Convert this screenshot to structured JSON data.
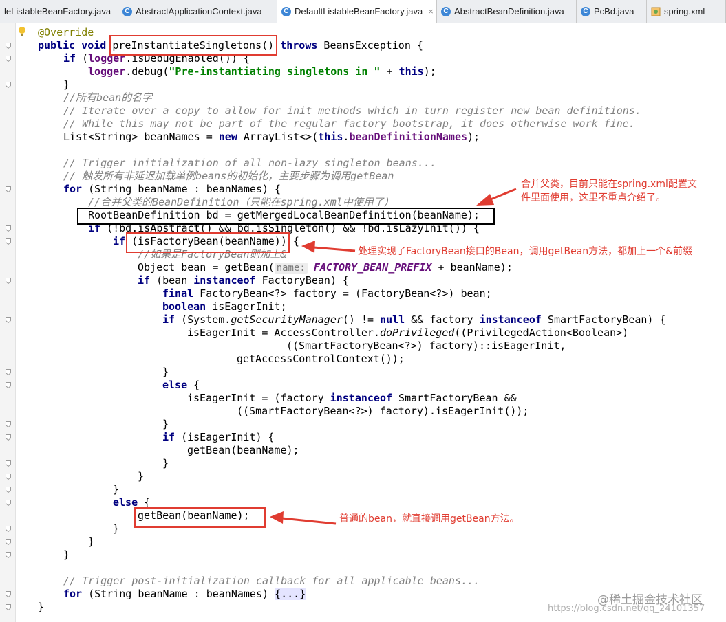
{
  "tabs": [
    {
      "label": "leListableBeanFactory.java",
      "icon": "none",
      "active": false
    },
    {
      "label": "AbstractApplicationContext.java",
      "icon": "class-icon",
      "active": false
    },
    {
      "label": "DefaultListableBeanFactory.java",
      "icon": "class-icon",
      "active": true
    },
    {
      "label": "AbstractBeanDefinition.java",
      "icon": "class-icon",
      "active": false
    },
    {
      "label": "PcBd.java",
      "icon": "class-icon",
      "active": false
    },
    {
      "label": "spring.xml",
      "icon": "xml-icon",
      "active": false
    }
  ],
  "tab_close": "×",
  "colors": {
    "keyword": "#000080",
    "comment": "#808080",
    "annotation": "#808000",
    "string": "#008000",
    "field": "#660e7a",
    "annotation_red": "#e03c31"
  },
  "code": {
    "annotation": "@Override",
    "l1_kw": "public void ",
    "l1_method": "preInstantiateSingletons()",
    "l1_throws": " throws",
    "l1_rest": " BeansException {",
    "l2_kw": "if",
    "l2_a": " (",
    "l2_logger": "logger",
    "l2_b": ".isDebugEnabled()) {",
    "l3_logger": "logger",
    "l3_a": ".debug(",
    "l3_str": "\"Pre-instantiating singletons in \"",
    "l3_b": " + ",
    "l3_this": "this",
    "l3_c": ");",
    "l4": "}",
    "c1": "//所有bean的名字",
    "c2": "// Iterate over a copy to allow for init methods which in turn register new bean definitions.",
    "c3": "// While this may not be part of the regular factory bootstrap, it does otherwise work fine.",
    "l8_a": "List<String> beanNames = ",
    "l8_new": "new",
    "l8_b": " ArrayList<>(",
    "l8_this": "this",
    "l8_c": ".",
    "l8_field": "beanDefinitionNames",
    "l8_d": ");",
    "c4": "// Trigger initialization of all non-lazy singleton beans...",
    "c5": "// 触发所有非延迟加载单例beans的初始化，主要步骤为调用getBean",
    "l12_for": "for",
    "l12_a": " (String beanName : beanNames) {",
    "c6": "//合并父类的BeanDefinition（只能在spring.xml中使用了）",
    "l14": "RootBeanDefinition bd = getMergedLocalBeanDefinition(beanName);",
    "l15_if": "if",
    "l15_a": " (!bd.isAbstract() && bd.isSingleton() && !bd.isLazyInit()) {",
    "l16_if": "if",
    "l16_a": " (isFactoryBean(beanName)) {",
    "c7": "//如果是FactoryBean则加上&",
    "l18_a": "Object bean = getBean(",
    "l18_hint": "name:",
    "l18_const": " FACTORY_BEAN_PREFIX",
    "l18_b": " + beanName);",
    "l19_if": "if",
    "l19_a": " (bean ",
    "l19_inst": "instanceof",
    "l19_b": " FactoryBean) {",
    "l20_final": "final",
    "l20_a": " FactoryBean<?> factory = (FactoryBean<?>) bean;",
    "l21_bool": "boolean",
    "l21_a": " isEagerInit;",
    "l22_if": "if",
    "l22_a": " (System.",
    "l22_it": "getSecurityManager",
    "l22_b": "() != ",
    "l22_null": "null",
    "l22_c": " && factory ",
    "l22_inst": "instanceof",
    "l22_d": " SmartFactoryBean) {",
    "l23_a": "isEagerInit = AccessController.",
    "l23_it": "doPrivileged",
    "l23_b": "((PrivilegedAction<Boolean>)",
    "l24": "((SmartFactoryBean<?>) factory)::isEagerInit,",
    "l25": "getAccessControlContext());",
    "l26": "}",
    "l27_else": "else",
    "l27_a": " {",
    "l28_a": "isEagerInit = (factory ",
    "l28_inst": "instanceof",
    "l28_b": " SmartFactoryBean &&",
    "l29": "((SmartFactoryBean<?>) factory).isEagerInit());",
    "l30": "}",
    "l31_if": "if",
    "l31_a": " (isEagerInit) {",
    "l32": "getBean(beanName);",
    "l33": "}",
    "l34": "}",
    "l35": "}",
    "l36_else": "else",
    "l36_a": " {",
    "l37": "getBean(beanName);",
    "l38": "}",
    "l39": "}",
    "l40": "}",
    "c8": "// Trigger post-initialization callback for all applicable beans...",
    "l42_for": "for",
    "l42_a": " (String beanName : beanNames) ",
    "l42_fold": "{...}",
    "l43": "}"
  },
  "notes": {
    "merge": "合并父类，目前只能在spring.xml配置文\n件里面使用，这里不重点介绍了。",
    "factory": "处理实现了FactoryBean接口的Bean，调用getBean方法，都加上一个&前缀",
    "normal": "普通的bean，就直接调用getBean方法。"
  },
  "watermark": {
    "site": "@稀土掘金技术社区",
    "url": "https://blog.csdn.net/qq_24101357"
  }
}
